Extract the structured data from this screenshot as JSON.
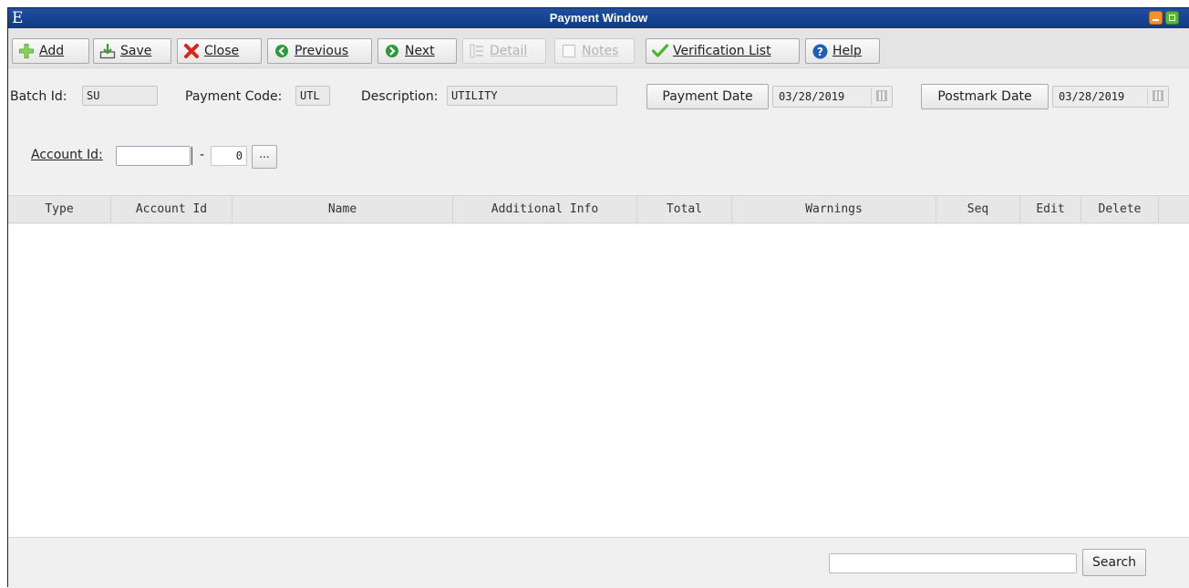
{
  "window": {
    "title": "Payment Window",
    "app_icon_letter": "E"
  },
  "toolbar": {
    "add_label": "Add",
    "save_label": "Save",
    "close_label": "Close",
    "previous_label": "Previous",
    "next_label": "Next",
    "detail_label": "Detail",
    "notes_label": "Notes",
    "verification_label": "Verification List",
    "help_label": "Help"
  },
  "form": {
    "batch_id_label": "Batch Id:",
    "batch_id_value": "SU",
    "payment_code_label": "Payment Code:",
    "payment_code_value": "UTL",
    "description_label": "Description:",
    "description_value": "UTILITY",
    "payment_date_button": "Payment Date",
    "payment_date_value": "03/28/2019",
    "postmark_date_button": "Postmark Date",
    "postmark_date_value": "03/28/2019",
    "account_id_label": "Account Id:",
    "account_id_value": "",
    "account_separator": "-",
    "account_suffix_value": "0",
    "lookup_button": "..."
  },
  "grid": {
    "columns": [
      "Type",
      "Account Id",
      "Name",
      "Additional Info",
      "Total",
      "Warnings",
      "Seq",
      "Edit",
      "Delete"
    ],
    "rows": []
  },
  "footer": {
    "search_value": "",
    "search_button": "Search"
  },
  "colors": {
    "titlebar": "#1f4ea3",
    "minimize": "#f29227",
    "maximize": "#5ab52f"
  },
  "icons": {
    "add": "plus-icon",
    "save": "save-download-icon",
    "close": "close-x-icon",
    "previous": "arrow-left-circle-icon",
    "next": "arrow-right-circle-icon",
    "detail": "list-icon",
    "notes": "notes-icon",
    "verification": "checkmark-icon",
    "help": "help-icon",
    "calendar": "calendar-icon"
  }
}
